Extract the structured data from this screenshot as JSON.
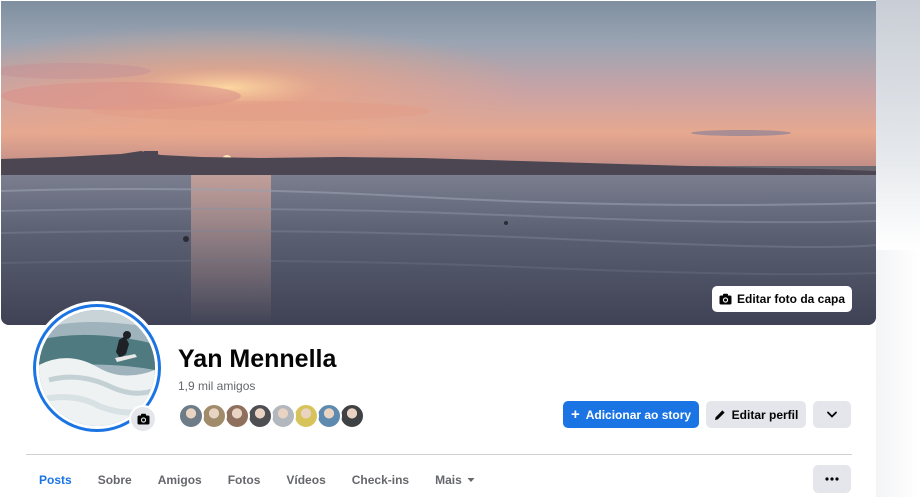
{
  "cover": {
    "edit_label": "Editar foto da capa"
  },
  "profile": {
    "name": "Yan Mennella",
    "friend_count": "1,9 mil amigos",
    "friend_avatar_colors": [
      "#6d7c86",
      "#a08c6b",
      "#8f6f5d",
      "#4d4f52",
      "#b2b8bd",
      "#d6c45a",
      "#5f8ab0",
      "#3f4244"
    ]
  },
  "actions": {
    "add_story_label": "Adicionar ao story",
    "edit_profile_label": "Editar perfil"
  },
  "tabs": [
    {
      "label": "Posts"
    },
    {
      "label": "Sobre"
    },
    {
      "label": "Amigos"
    },
    {
      "label": "Fotos"
    },
    {
      "label": "Vídeos"
    },
    {
      "label": "Check-ins"
    },
    {
      "label": "Mais"
    }
  ],
  "colors": {
    "accent": "#1b74e4",
    "secondary_button": "#e4e6eb",
    "muted_text": "#65676b"
  }
}
